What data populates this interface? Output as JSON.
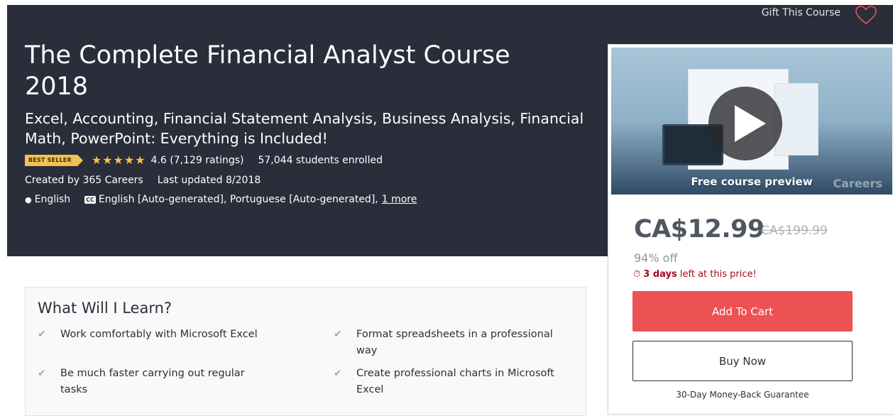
{
  "header": {
    "gift_label": "Gift This Course",
    "wishlist_icon": "heart-icon"
  },
  "course": {
    "title": "The Complete Financial Analyst Course 2018",
    "subtitle": "Excel, Accounting, Financial Statement Analysis, Business Analysis, Financial Math, PowerPoint: Everything is Included!",
    "badge": "BEST SELLER",
    "stars": "★★★★★",
    "rating": "4.6 (7,129 ratings)",
    "enrolled": "57,044 students enrolled",
    "created_by": "Created by 365 Careers",
    "last_updated": "Last updated 8/2018",
    "language": "English",
    "captions": "English [Auto-generated], Portuguese [Auto-generated],",
    "captions_more": "1 more"
  },
  "sidebar": {
    "preview_label": "Free course preview",
    "watermark": "Careers",
    "price": "CA$12.99",
    "old_price": "CA$199.99",
    "discount": "94% off",
    "timer_days": "3 days",
    "timer_text": " left at this price!",
    "add_to_cart": "Add To Cart",
    "buy_now": "Buy Now",
    "guarantee": "30-Day Money-Back Guarantee"
  },
  "learn": {
    "title": "What Will I Learn?",
    "items": [
      "Work comfortably with Microsoft Excel",
      "Format spreadsheets in a professional way",
      "Be much faster carrying out regular tasks",
      "Create professional charts in Microsoft Excel"
    ]
  },
  "colors": {
    "hero_bg": "#2a2d3a",
    "badge": "#f4c150",
    "cart": "#ec5252",
    "timer": "#a2091f"
  }
}
